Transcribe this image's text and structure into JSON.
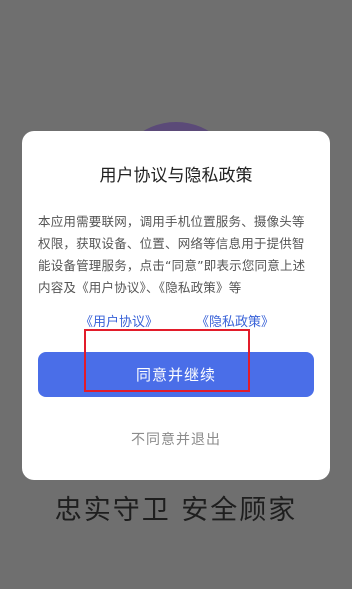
{
  "background": {
    "slogan": "忠实守卫 安全顾家"
  },
  "dialog": {
    "title": "用户协议与隐私政策",
    "body": "本应用需要联网，调用手机位置服务、摄像头等权限，获取设备、位置、网络等信息用于提供智能设备管理服务，点击“同意”即表示您同意上述内容及《用户协议》、《隐私政策》等",
    "link_user_agreement": "《用户协议》",
    "link_privacy_policy": "《隐私政策》",
    "agree_button": "同意并继续",
    "decline_button": "不同意并退出"
  },
  "colors": {
    "accent": "#4a6ee8",
    "link": "#3a63d8",
    "highlight": "#e21c2a",
    "overlay": "#6f6f6f"
  }
}
